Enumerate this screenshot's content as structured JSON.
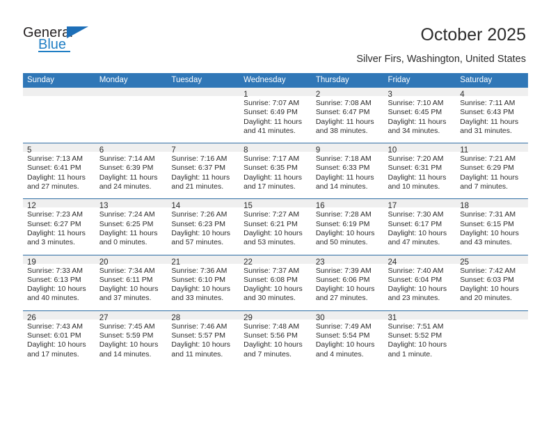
{
  "brand": {
    "name_top": "General",
    "name_bottom": "Blue",
    "triangle_color": "#1d6fb8",
    "blue_color": "#1f7ec4"
  },
  "header": {
    "title": "October 2025",
    "subtitle": "Silver Firs, Washington, United States",
    "header_bg": "#3077b7",
    "daynum_bg": "#efefef"
  },
  "weekdays": [
    "Sunday",
    "Monday",
    "Tuesday",
    "Wednesday",
    "Thursday",
    "Friday",
    "Saturday"
  ],
  "labels": {
    "sunrise": "Sunrise:",
    "sunset": "Sunset:",
    "daylight": "Daylight:"
  },
  "weeks": [
    [
      {
        "day": ""
      },
      {
        "day": ""
      },
      {
        "day": ""
      },
      {
        "day": "1",
        "sunrise": "Sunrise: 7:07 AM",
        "sunset": "Sunset: 6:49 PM",
        "daylight": "Daylight: 11 hours and 41 minutes."
      },
      {
        "day": "2",
        "sunrise": "Sunrise: 7:08 AM",
        "sunset": "Sunset: 6:47 PM",
        "daylight": "Daylight: 11 hours and 38 minutes."
      },
      {
        "day": "3",
        "sunrise": "Sunrise: 7:10 AM",
        "sunset": "Sunset: 6:45 PM",
        "daylight": "Daylight: 11 hours and 34 minutes."
      },
      {
        "day": "4",
        "sunrise": "Sunrise: 7:11 AM",
        "sunset": "Sunset: 6:43 PM",
        "daylight": "Daylight: 11 hours and 31 minutes."
      }
    ],
    [
      {
        "day": "5",
        "sunrise": "Sunrise: 7:13 AM",
        "sunset": "Sunset: 6:41 PM",
        "daylight": "Daylight: 11 hours and 27 minutes."
      },
      {
        "day": "6",
        "sunrise": "Sunrise: 7:14 AM",
        "sunset": "Sunset: 6:39 PM",
        "daylight": "Daylight: 11 hours and 24 minutes."
      },
      {
        "day": "7",
        "sunrise": "Sunrise: 7:16 AM",
        "sunset": "Sunset: 6:37 PM",
        "daylight": "Daylight: 11 hours and 21 minutes."
      },
      {
        "day": "8",
        "sunrise": "Sunrise: 7:17 AM",
        "sunset": "Sunset: 6:35 PM",
        "daylight": "Daylight: 11 hours and 17 minutes."
      },
      {
        "day": "9",
        "sunrise": "Sunrise: 7:18 AM",
        "sunset": "Sunset: 6:33 PM",
        "daylight": "Daylight: 11 hours and 14 minutes."
      },
      {
        "day": "10",
        "sunrise": "Sunrise: 7:20 AM",
        "sunset": "Sunset: 6:31 PM",
        "daylight": "Daylight: 11 hours and 10 minutes."
      },
      {
        "day": "11",
        "sunrise": "Sunrise: 7:21 AM",
        "sunset": "Sunset: 6:29 PM",
        "daylight": "Daylight: 11 hours and 7 minutes."
      }
    ],
    [
      {
        "day": "12",
        "sunrise": "Sunrise: 7:23 AM",
        "sunset": "Sunset: 6:27 PM",
        "daylight": "Daylight: 11 hours and 3 minutes."
      },
      {
        "day": "13",
        "sunrise": "Sunrise: 7:24 AM",
        "sunset": "Sunset: 6:25 PM",
        "daylight": "Daylight: 11 hours and 0 minutes."
      },
      {
        "day": "14",
        "sunrise": "Sunrise: 7:26 AM",
        "sunset": "Sunset: 6:23 PM",
        "daylight": "Daylight: 10 hours and 57 minutes."
      },
      {
        "day": "15",
        "sunrise": "Sunrise: 7:27 AM",
        "sunset": "Sunset: 6:21 PM",
        "daylight": "Daylight: 10 hours and 53 minutes."
      },
      {
        "day": "16",
        "sunrise": "Sunrise: 7:28 AM",
        "sunset": "Sunset: 6:19 PM",
        "daylight": "Daylight: 10 hours and 50 minutes."
      },
      {
        "day": "17",
        "sunrise": "Sunrise: 7:30 AM",
        "sunset": "Sunset: 6:17 PM",
        "daylight": "Daylight: 10 hours and 47 minutes."
      },
      {
        "day": "18",
        "sunrise": "Sunrise: 7:31 AM",
        "sunset": "Sunset: 6:15 PM",
        "daylight": "Daylight: 10 hours and 43 minutes."
      }
    ],
    [
      {
        "day": "19",
        "sunrise": "Sunrise: 7:33 AM",
        "sunset": "Sunset: 6:13 PM",
        "daylight": "Daylight: 10 hours and 40 minutes."
      },
      {
        "day": "20",
        "sunrise": "Sunrise: 7:34 AM",
        "sunset": "Sunset: 6:11 PM",
        "daylight": "Daylight: 10 hours and 37 minutes."
      },
      {
        "day": "21",
        "sunrise": "Sunrise: 7:36 AM",
        "sunset": "Sunset: 6:10 PM",
        "daylight": "Daylight: 10 hours and 33 minutes."
      },
      {
        "day": "22",
        "sunrise": "Sunrise: 7:37 AM",
        "sunset": "Sunset: 6:08 PM",
        "daylight": "Daylight: 10 hours and 30 minutes."
      },
      {
        "day": "23",
        "sunrise": "Sunrise: 7:39 AM",
        "sunset": "Sunset: 6:06 PM",
        "daylight": "Daylight: 10 hours and 27 minutes."
      },
      {
        "day": "24",
        "sunrise": "Sunrise: 7:40 AM",
        "sunset": "Sunset: 6:04 PM",
        "daylight": "Daylight: 10 hours and 23 minutes."
      },
      {
        "day": "25",
        "sunrise": "Sunrise: 7:42 AM",
        "sunset": "Sunset: 6:03 PM",
        "daylight": "Daylight: 10 hours and 20 minutes."
      }
    ],
    [
      {
        "day": "26",
        "sunrise": "Sunrise: 7:43 AM",
        "sunset": "Sunset: 6:01 PM",
        "daylight": "Daylight: 10 hours and 17 minutes."
      },
      {
        "day": "27",
        "sunrise": "Sunrise: 7:45 AM",
        "sunset": "Sunset: 5:59 PM",
        "daylight": "Daylight: 10 hours and 14 minutes."
      },
      {
        "day": "28",
        "sunrise": "Sunrise: 7:46 AM",
        "sunset": "Sunset: 5:57 PM",
        "daylight": "Daylight: 10 hours and 11 minutes."
      },
      {
        "day": "29",
        "sunrise": "Sunrise: 7:48 AM",
        "sunset": "Sunset: 5:56 PM",
        "daylight": "Daylight: 10 hours and 7 minutes."
      },
      {
        "day": "30",
        "sunrise": "Sunrise: 7:49 AM",
        "sunset": "Sunset: 5:54 PM",
        "daylight": "Daylight: 10 hours and 4 minutes."
      },
      {
        "day": "31",
        "sunrise": "Sunrise: 7:51 AM",
        "sunset": "Sunset: 5:52 PM",
        "daylight": "Daylight: 10 hours and 1 minute."
      },
      {
        "day": ""
      }
    ]
  ]
}
